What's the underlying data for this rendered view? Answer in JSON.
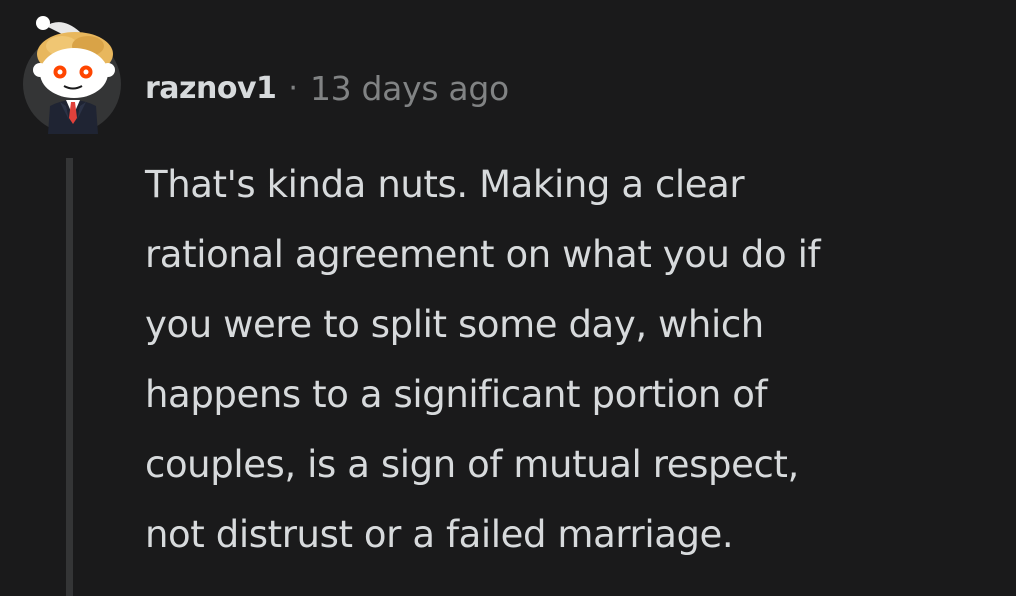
{
  "comment": {
    "username": "raznov1",
    "separator": "·",
    "timestamp": "13 days ago",
    "avatar_icon": "snoo-avatar-icon",
    "body_lines": [
      "That's kinda nuts. Making a clear",
      "rational agreement on what you do if",
      "you were to split some day, which",
      "happens to a significant portion of",
      "couples, is a sign of mutual respect,",
      "not distrust or a failed marriage."
    ]
  },
  "colors": {
    "background": "#1a1a1b",
    "text_primary": "#d7dadc",
    "text_secondary": "#818384",
    "thread_line": "#343536"
  }
}
